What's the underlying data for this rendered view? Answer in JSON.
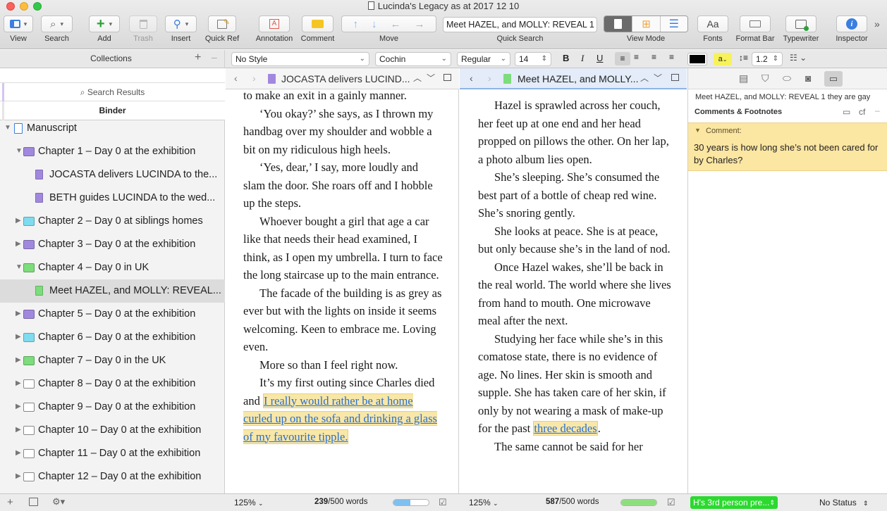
{
  "window": {
    "title": "Lucinda's Legacy as at 2017 12 10"
  },
  "toolbar": {
    "view": "View",
    "search": "Search",
    "add": "Add",
    "trash": "Trash",
    "insert": "Insert",
    "quick_ref": "Quick Ref",
    "annotation": "Annotation",
    "comment": "Comment",
    "move": "Move",
    "quick_search_value": "Meet HAZEL, and MOLLY: REVEAL 1 the...",
    "quick_search": "Quick Search",
    "view_mode": "View Mode",
    "fonts": "Fonts",
    "fonts_glyph": "Aa",
    "format_bar": "Format Bar",
    "typewriter": "Typewriter",
    "inspector": "Inspector",
    "more": "»"
  },
  "format_bar": {
    "collections": "Collections",
    "style": "No Style",
    "font": "Cochin",
    "weight": "Regular",
    "size": "14",
    "bold": "B",
    "italic": "I",
    "underline": "U",
    "line_spacing": "1.2",
    "highlight": "a",
    "text_color": "#000000",
    "highlight_color": "#f7f25a"
  },
  "sidebar": {
    "search_results": "Search Results",
    "binder": "Binder",
    "items": [
      {
        "label": "Manuscript",
        "icon": "manuscript-icon"
      },
      {
        "label": "Chapter 1 – Day 0 at the exhibition",
        "icon": "folder-icon",
        "color": "#a188df"
      },
      {
        "label": "JOCASTA delivers LUCINDA to the...",
        "icon": "document-icon",
        "color": "#a188df"
      },
      {
        "label": "BETH guides LUCINDA to the wed...",
        "icon": "document-icon",
        "color": "#a188df"
      },
      {
        "label": "Chapter 2 – Day 0 at siblings homes",
        "icon": "folder-icon",
        "color": "#7fdbef"
      },
      {
        "label": "Chapter 3 – Day 0 at the exhibition",
        "icon": "folder-icon",
        "color": "#a188df"
      },
      {
        "label": "Chapter 4 – Day 0 in UK",
        "icon": "folder-icon",
        "color": "#7ddc7b"
      },
      {
        "label": "Meet HAZEL, and MOLLY: REVEAL...",
        "icon": "document-icon",
        "color": "#7ddc7b"
      },
      {
        "label": "Chapter 5 – Day 0 at the exhibition",
        "icon": "folder-icon",
        "color": "#a188df"
      },
      {
        "label": "Chapter 6 – Day 0 at the exhibition",
        "icon": "folder-icon",
        "color": "#7fdbef"
      },
      {
        "label": "Chapter 7 – Day 0 in the UK",
        "icon": "folder-icon",
        "color": "#7ddc7b"
      },
      {
        "label": "Chapter 8 – Day 0 at the exhibition",
        "icon": "folder-icon",
        "color": "#ffffff"
      },
      {
        "label": "Chapter 9 – Day 0 at the exhibition",
        "icon": "folder-icon",
        "color": "#ffffff"
      },
      {
        "label": "Chapter 10 – Day 0 at the exhibition",
        "icon": "folder-icon",
        "color": "#ffffff"
      },
      {
        "label": "Chapter 11 – Day 0 at the exhibition",
        "icon": "folder-icon",
        "color": "#ffffff"
      },
      {
        "label": "Chapter 12 – Day 0 at the exhibition",
        "icon": "folder-icon",
        "color": "#ffffff"
      }
    ]
  },
  "editor_left": {
    "header_title": "JOCASTA delivers LUCIND...",
    "paragraphs": [
      "to make an exit in a gainly manner.",
      "‘You okay?’ she says, as I thrown my handbag over my shoulder and wobble a bit on my ridiculous high heels.",
      "‘Yes, dear,’ I say, more loudly and slam the door. She roars off and I hobble up the steps.",
      "Whoever bought a girl that age a car like that needs their head examined, I think, as I open my umbrella. I turn to face the long staircase up to the main entrance.",
      "The facade of the building is as grey as ever but with the lights on inside it seems welcoming. Keen to embrace me. Loving even.",
      "More so than I feel right now."
    ],
    "last_para_start": "It’s my first outing since Charles died and ",
    "last_para_highlight": "I really would rather be at home curled up on the sofa and drinking a glass of my favourite tipple.",
    "zoom": "125%",
    "word_count": "239",
    "word_target": "/500 words",
    "progress": 0.478
  },
  "editor_right": {
    "header_title": "Meet HAZEL, and MOLLY...",
    "paragraphs": [
      "Hazel is sprawled across her couch, her feet up at one end and her head propped on pillows the other. On her lap, a photo album lies open.",
      "She’s sleeping. She’s consumed the best part of a bottle of cheap red wine. She’s snoring gently.",
      "She looks at peace. She is at peace, but only because she’s in the land of nod.",
      "Once Hazel wakes, she’ll be back in the real world. The world where she lives from hand to mouth. One microwave meal after the next."
    ],
    "para5_start": "Studying her face while she’s in this comatose state, there is no evidence of age. No lines. Her skin is smooth and supple. She has taken care of her skin, if only by not wearing a mask of make-up for the past ",
    "para5_highlight": "three decades",
    "para5_end": ".",
    "last_para": "The same cannot be said for her",
    "zoom": "125%",
    "word_count": "587",
    "word_target": "/500 words",
    "progress": 1.0
  },
  "inspector": {
    "doc_title": "Meet HAZEL, and MOLLY: REVEAL 1 they are gay",
    "section": "Comments & Footnotes",
    "cf": "cf",
    "comment_label": "Comment:",
    "comment_text": "30 years is how long she’s not been cared for by Charles?",
    "label_value": "H's 3rd person pre...",
    "label_color": "#2bd92f",
    "status_value": "No Status"
  }
}
